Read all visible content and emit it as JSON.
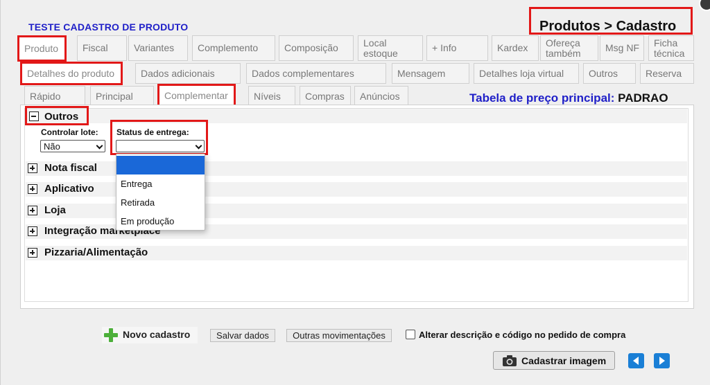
{
  "header": {
    "app_title": "TESTE CADASTRO DE PRODUTO",
    "breadcrumb": "Produtos > Cadastro"
  },
  "tabs_row1": [
    {
      "label": "Produto",
      "state": "active",
      "highlighted": true
    },
    {
      "label": "Fiscal"
    },
    {
      "label": "Variantes"
    },
    {
      "label": "Complemento"
    },
    {
      "label": "Composição"
    },
    {
      "label": "Local estoque"
    },
    {
      "label": "+ Info"
    },
    {
      "label": "Kardex"
    },
    {
      "label": "Ofereça também"
    },
    {
      "label": "Msg NF"
    },
    {
      "label": "Ficha técnica"
    }
  ],
  "tabs_row2": [
    {
      "label": "Detalhes do produto",
      "state": "active",
      "highlighted": true
    },
    {
      "label": "Dados adicionais"
    },
    {
      "label": "Dados complementares"
    },
    {
      "label": "Mensagem"
    },
    {
      "label": "Detalhes loja virtual"
    },
    {
      "label": "Outros"
    },
    {
      "label": "Reserva"
    }
  ],
  "tabs_row3": [
    {
      "label": "Rápido"
    },
    {
      "label": "Principal"
    },
    {
      "label": "Complementar",
      "state": "active",
      "highlighted": true
    },
    {
      "label": "Níveis"
    },
    {
      "label": "Compras"
    },
    {
      "label": "Anúncios"
    }
  ],
  "price_table": {
    "label": "Tabela de preço principal:",
    "value": "PADRAO"
  },
  "sections": {
    "outros": {
      "label": "Outros",
      "expanded": true,
      "controlar_lote_label": "Controlar lote:",
      "controlar_lote_value": "Não",
      "status_entrega_label": "Status de entrega:",
      "status_entrega_value": "",
      "status_entrega_options": [
        "",
        "Entrega",
        "Retirada",
        "Em produção"
      ]
    },
    "collapsed": [
      "Nota fiscal",
      "Aplicativo",
      "Loja",
      "Integração marketplace",
      "Pizzaria/Alimentação"
    ]
  },
  "footer": {
    "novo_cadastro": "Novo cadastro",
    "salvar_dados": "Salvar dados",
    "outras_movimentacoes": "Outras movimentações",
    "alterar_checkbox_label": "Alterar descrição e código no pedido de compra",
    "alterar_checked": false,
    "cadastrar_imagem": "Cadastrar imagem"
  },
  "icons": {
    "novo": "plus-icon",
    "camera": "camera-icon",
    "prev": "arrow-left-icon",
    "next": "arrow-right-icon",
    "close": "close-icon"
  },
  "colors": {
    "highlight": "#e21818",
    "title_blue": "#1f1fc8",
    "selection_blue": "#1a68d8",
    "nav_blue": "#1a7fd6",
    "plus_green": "#4caf3a"
  }
}
